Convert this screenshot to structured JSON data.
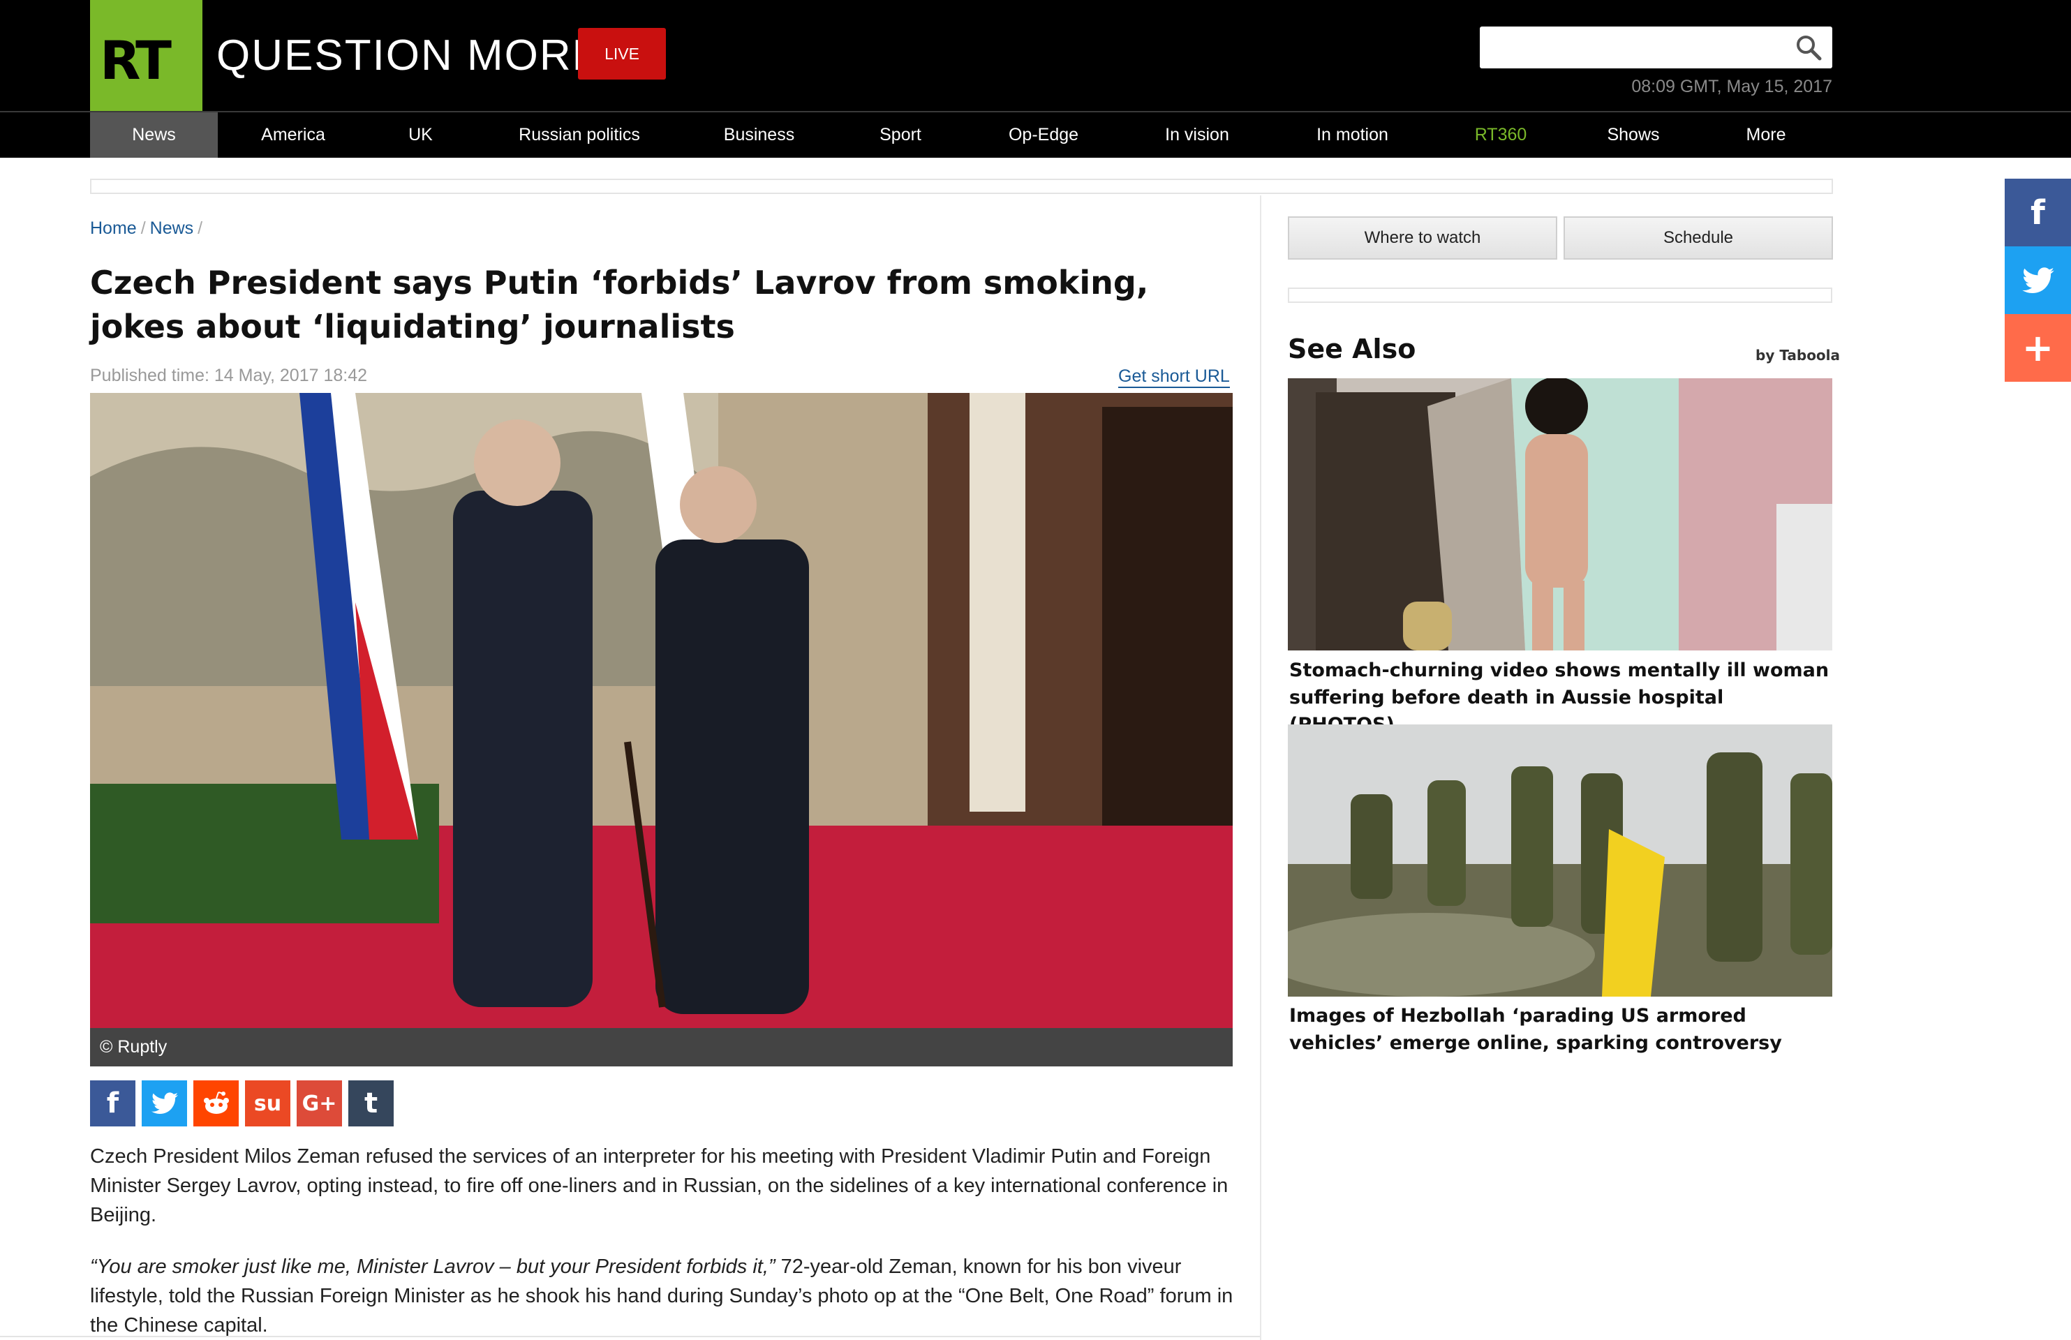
{
  "header": {
    "logo_text": "RT",
    "tagline": "QUESTION MORE",
    "live_label": "LIVE",
    "search_placeholder": "",
    "datetime": "08:09 GMT, May 15, 2017"
  },
  "nav": [
    {
      "label": "News",
      "active": true
    },
    {
      "label": "America"
    },
    {
      "label": "UK"
    },
    {
      "label": "Russian politics"
    },
    {
      "label": "Business"
    },
    {
      "label": "Sport"
    },
    {
      "label": "Op-Edge"
    },
    {
      "label": "In vision"
    },
    {
      "label": "In motion"
    },
    {
      "label": "RT360",
      "highlight": true
    },
    {
      "label": "Shows"
    },
    {
      "label": "More"
    }
  ],
  "breadcrumb": {
    "home": "Home",
    "section": "News"
  },
  "article": {
    "headline": "Czech President says Putin ‘forbids’ Lavrov from smoking, jokes about ‘liquidating’ journalists",
    "published": "Published time: 14 May, 2017 18:42",
    "short_url_label": "Get short URL",
    "image_caption": "© Ruptly",
    "para1": "Czech President Milos Zeman refused the services of an interpreter for his meeting with President Vladimir Putin and Foreign Minister Sergey Lavrov, opting instead, to fire off one-liners and in Russian, on the sidelines of a key international conference in Beijing.",
    "para2_quote": "“You are smoker just like me, Minister Lavrov – but your President forbids it,”",
    "para2_rest": " 72-year-old Zeman, known for his bon viveur lifestyle, told the Russian Foreign Minister as he shook his hand during Sunday’s photo op at the “One Belt, One Road” forum in the Chinese capital."
  },
  "share_buttons": [
    {
      "name": "facebook",
      "glyph": "f",
      "color": "#3b5998"
    },
    {
      "name": "twitter",
      "glyph": "t",
      "color": "#1da1f2"
    },
    {
      "name": "reddit",
      "glyph": "r",
      "color": "#ff4500"
    },
    {
      "name": "stumbleupon",
      "glyph": "su",
      "color": "#eb4924"
    },
    {
      "name": "google-plus",
      "glyph": "G+",
      "color": "#dd4b39"
    },
    {
      "name": "tumblr",
      "glyph": "t",
      "color": "#35465c"
    }
  ],
  "sidebar": {
    "where_to_watch": "Where to watch",
    "schedule": "Schedule",
    "see_also": "See Also",
    "by_taboola": "by Taboola",
    "items": [
      {
        "title": "Stomach-churning video shows mentally ill woman suffering before death in Aussie hospital (PHOTOS)"
      },
      {
        "title": "Images of Hezbollah ‘parading US armored vehicles’ emerge online, sparking controversy"
      }
    ]
  },
  "floating_share": [
    {
      "name": "facebook",
      "color": "#3b5998"
    },
    {
      "name": "twitter",
      "color": "#1da1f2"
    },
    {
      "name": "more",
      "color": "#ff6b4a"
    }
  ],
  "colors": {
    "brand_green": "#7ab929",
    "live_red": "#c9100f",
    "link_blue": "#1a5a96"
  }
}
